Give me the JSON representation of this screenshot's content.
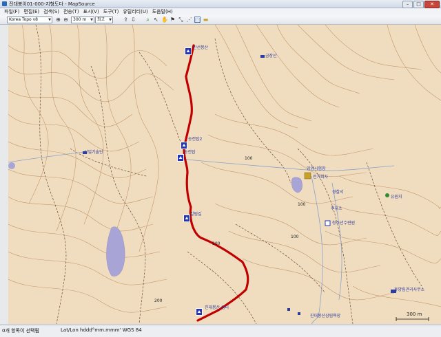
{
  "window": {
    "title": "진대봉이01-000-지형도다 - MapSource",
    "minimize": "–",
    "maximize": "□",
    "close": "✕"
  },
  "menu": [
    {
      "label": "파일(F)"
    },
    {
      "label": "편집(E)"
    },
    {
      "label": "검색(S)"
    },
    {
      "label": "전송(T)"
    },
    {
      "label": "표시(V)"
    },
    {
      "label": "도구(T)"
    },
    {
      "label": "유틸리티(U)"
    },
    {
      "label": "도움말(H)"
    }
  ],
  "toolbar": {
    "product": "Korea Topo v8",
    "zoom": "300 m",
    "detail": "최고"
  },
  "map": {
    "colors": {
      "land": "#f0ddbf",
      "contour": "#b98a5c",
      "trail": "#6d4a36",
      "route": "#c00000",
      "road": "#8aa2c8",
      "water": "#a8a5d6"
    },
    "scale_label": "300 m",
    "labels": [
      {
        "text": "만선봉산"
      },
      {
        "text": "금장산"
      },
      {
        "text": "송전탑2"
      },
      {
        "text": "송전탑"
      },
      {
        "text": "갈림길"
      },
      {
        "text": "100"
      },
      {
        "text": "100"
      },
      {
        "text": "100"
      },
      {
        "text": "200"
      },
      {
        "text": "200"
      },
      {
        "text": "진대봉산 쉼터"
      },
      {
        "text": "산업기술단"
      },
      {
        "text": "임업시험장"
      },
      {
        "text": "전기회사"
      },
      {
        "text": "경찰서"
      },
      {
        "text": "주유소"
      },
      {
        "text": "청소년수련원"
      },
      {
        "text": "유원지"
      },
      {
        "text": "휴양림관리사무소"
      },
      {
        "text": "진대봉산삼림욕장"
      }
    ]
  },
  "status": {
    "hint": "0개 항목이 선택됨",
    "format": "Lat/Lon hddd°mm.mmm' WGS 84"
  }
}
